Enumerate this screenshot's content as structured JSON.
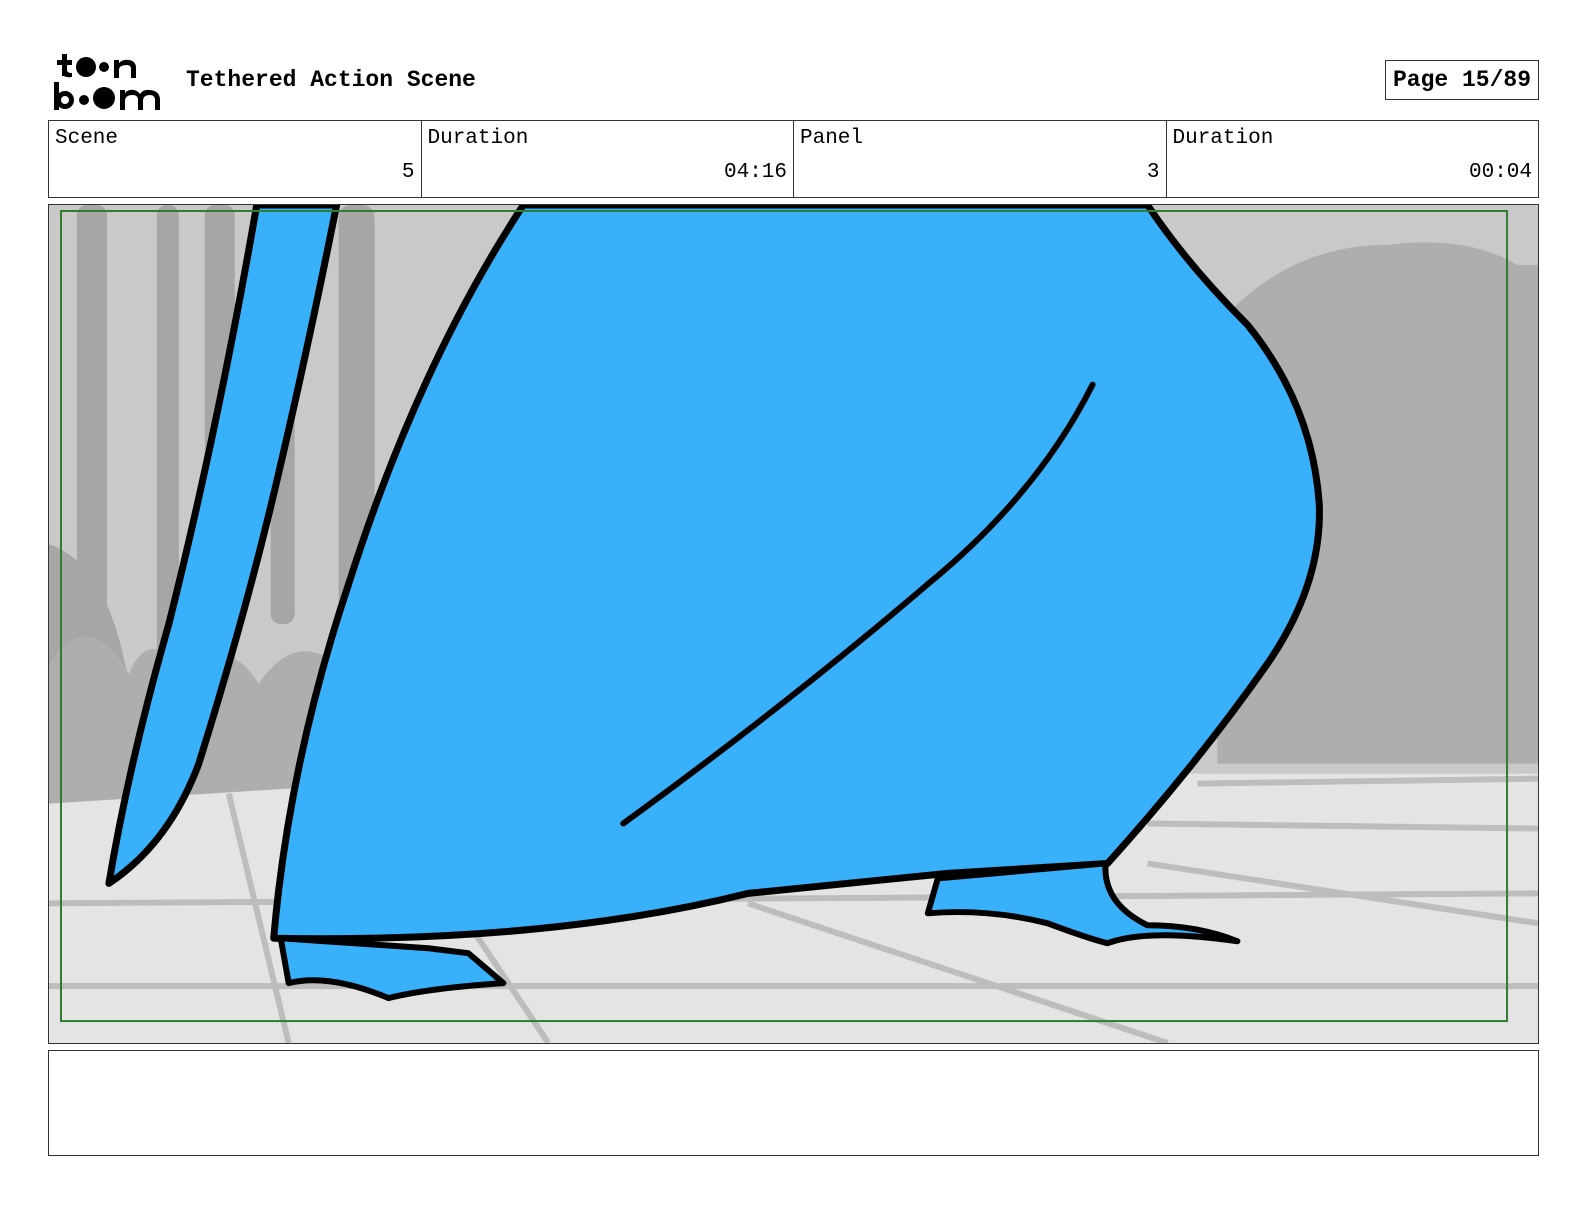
{
  "header": {
    "title": "Tethered Action Scene",
    "page_label": "Page 15/89",
    "logo_name": "toon-boom-logo"
  },
  "info": {
    "scene_label": "Scene",
    "scene_value": "5",
    "scene_duration_label": "Duration",
    "scene_duration_value": "04:16",
    "panel_label": "Panel",
    "panel_value": "3",
    "panel_duration_label": "Duration",
    "panel_duration_value": "00:04"
  },
  "caption": {
    "text": ""
  },
  "colors": {
    "character_fill": "#38B0FA",
    "safe_frame": "#2E7D32",
    "floor": "#E4E4E4",
    "background_wall": "#C8C8C8"
  }
}
